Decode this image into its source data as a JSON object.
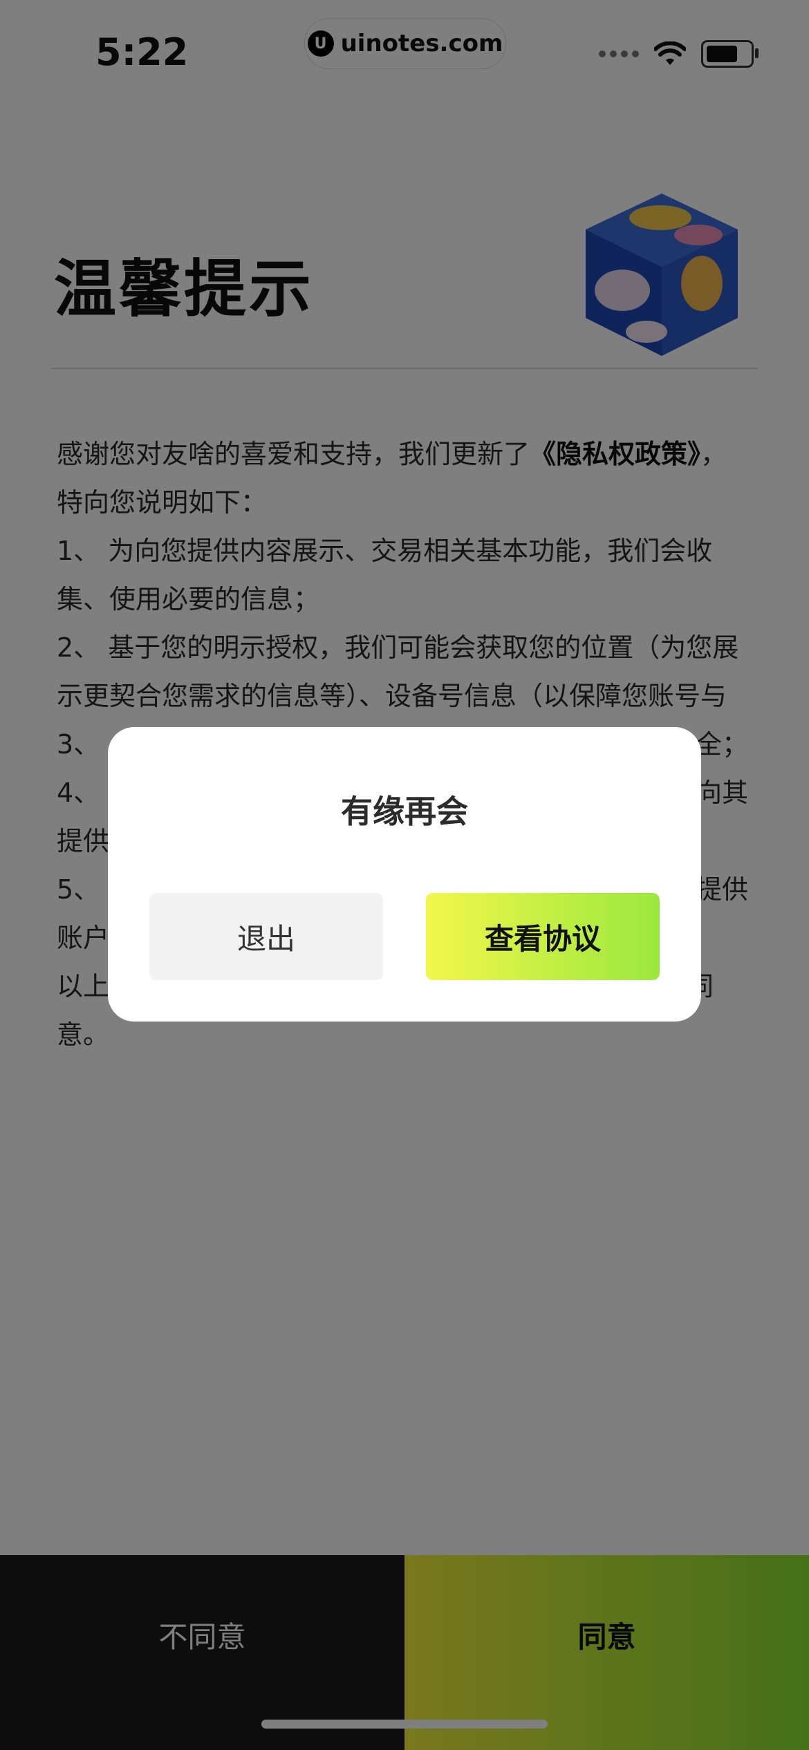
{
  "status_bar": {
    "time": "5:22",
    "site": "uinotes.com",
    "site_logo": "U"
  },
  "page": {
    "title": "温馨提示",
    "intro_prefix": "感谢您对友啥的喜爱和支持，我们更新了",
    "policy_link": "《隐私权政策》",
    "intro_suffix": "，特向您说明如下：",
    "items": [
      "1、 为向您提供内容展示、交易相关基本功能，我们会收集、使用必要的信息；",
      "2、 基于您的明示授权，我们可能会获取您的位置（为您展示更契合您需求的信息等）、设备号信息（以保障您账号与",
      "3、",
      "4、",
      "提供",
      "5、",
      "账户"
    ],
    "item3_tail": "全；",
    "item4_tail": "向其",
    "item5_tail": "提供",
    "closing": "以上修改具体以政策内容为准。若您不赞同，请选择不同意。"
  },
  "bottom_bar": {
    "disagree_label": "不同意",
    "agree_label": "同意"
  },
  "modal": {
    "title": "有缘再会",
    "exit_label": "退出",
    "view_label": "查看协议"
  },
  "colors": {
    "accent_start": "#f2f03a",
    "accent_end": "#89e331",
    "overlay": "rgba(0,0,0,0.5)"
  }
}
